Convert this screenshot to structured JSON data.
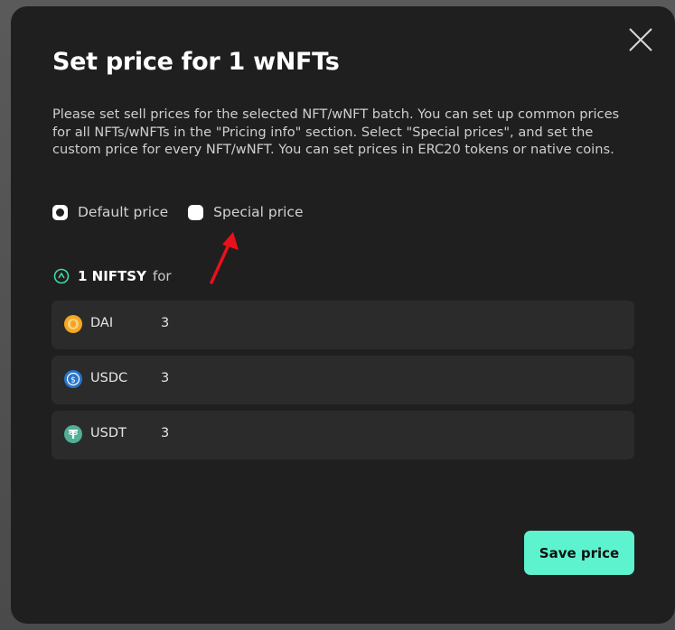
{
  "modal": {
    "title": "Set price for 1 wNFTs",
    "description": "Please set sell prices for the selected NFT/wNFT batch. You can set up common prices for all NFTs/wNFTs in the \"Pricing info\" section. Select \"Special prices\", and set the custom price for every NFT/wNFT. You can set prices in ERC20 tokens or native coins.",
    "close_icon": "close-icon"
  },
  "price_mode": {
    "options": [
      {
        "label": "Default price",
        "selected": true
      },
      {
        "label": "Special price",
        "selected": false
      }
    ]
  },
  "amount": {
    "value": "1 NIFTSY",
    "connector": "for",
    "icon": "niftsy-icon"
  },
  "prices": [
    {
      "token": "DAI",
      "price": "3",
      "icon": "dai-icon",
      "color": "#f5a623"
    },
    {
      "token": "USDC",
      "price": "3",
      "icon": "usdc-icon",
      "color": "#2775ca"
    },
    {
      "token": "USDT",
      "price": "3",
      "icon": "usdt-icon",
      "color": "#50af95"
    }
  ],
  "actions": {
    "save_label": "Save price"
  },
  "colors": {
    "modal_bg": "#1f1f1f",
    "row_bg": "#2b2b2b",
    "accent": "#5ef3cf",
    "annotation_arrow": "#e8111b"
  }
}
